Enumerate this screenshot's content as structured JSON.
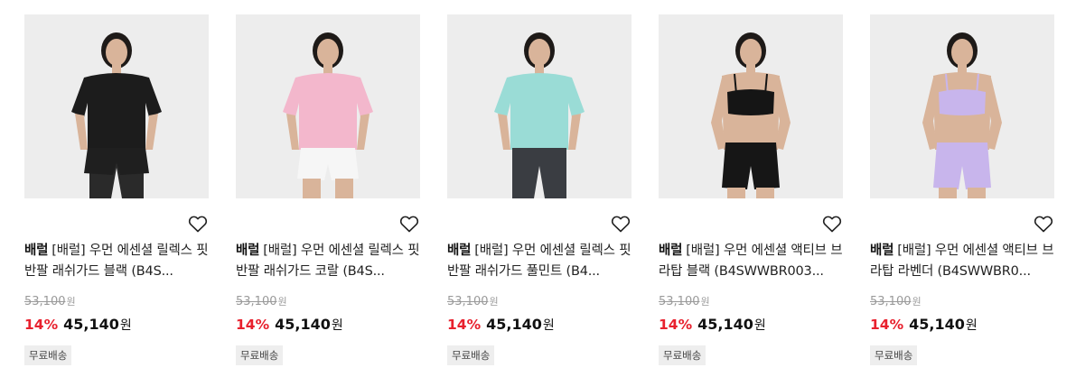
{
  "currency_unit": "원",
  "products": [
    {
      "brand": "배럴",
      "name": "[배럴] 우먼 에센셜 릴렉스 핏 반팔 래쉬가드 블랙 (B4S...",
      "original_price": "53,100",
      "discount_rate": "14%",
      "sale_price": "45,140",
      "badge": "무료배송",
      "top_color": "#1c1c1c",
      "bottom_color": "#1f1f1f",
      "bottom_style": "shorts-leggings"
    },
    {
      "brand": "배럴",
      "name": "[배럴] 우먼 에센셜 릴렉스 핏 반팔 래쉬가드 코랄 (B4S...",
      "original_price": "53,100",
      "discount_rate": "14%",
      "sale_price": "45,140",
      "badge": "무료배송",
      "top_color": "#f3b7cc",
      "bottom_color": "#f6f6f6",
      "bottom_style": "shorts"
    },
    {
      "brand": "배럴",
      "name": "[배럴] 우먼 에센셜 릴렉스 핏 반팔 래쉬가드 풀민트 (B4...",
      "original_price": "53,100",
      "discount_rate": "14%",
      "sale_price": "45,140",
      "badge": "무료배송",
      "top_color": "#9adcd6",
      "bottom_color": "#3a3d42",
      "bottom_style": "leggings"
    },
    {
      "brand": "배럴",
      "name": "[배럴] 우먼 에센셜 액티브 브라탑 블랙 (B4SWWBR003...",
      "original_price": "53,100",
      "discount_rate": "14%",
      "sale_price": "45,140",
      "badge": "무료배송",
      "top_color": "#151515",
      "bottom_color": "#161616",
      "bottom_style": "bra-shorts"
    },
    {
      "brand": "배럴",
      "name": "[배럴] 우먼 에센셜 액티브 브라탑 라벤더 (B4SWWBR0...",
      "original_price": "53,100",
      "discount_rate": "14%",
      "sale_price": "45,140",
      "badge": "무료배송",
      "top_color": "#c8b5ec",
      "bottom_color": "#c8b5ec",
      "bottom_style": "bra-shorts"
    }
  ]
}
